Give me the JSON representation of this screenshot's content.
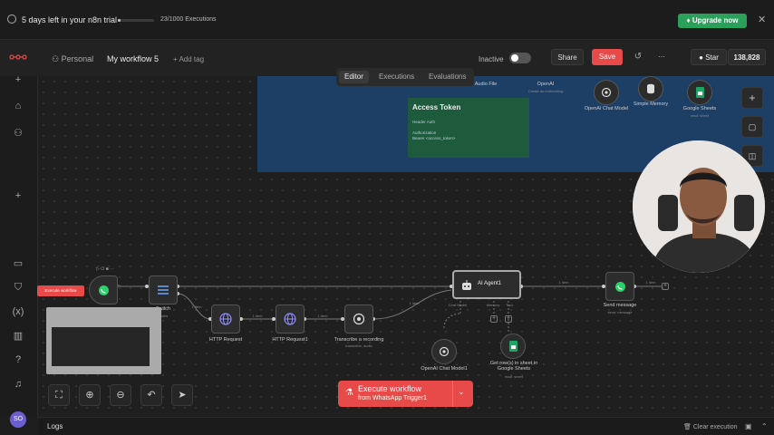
{
  "banner": {
    "trial_text": "5 days left in your n8n trial",
    "executions": "23/1000 Executions",
    "upgrade_label": "Upgrade now",
    "trial_progress": 0.023
  },
  "header": {
    "project": "Personal",
    "workflow_name": "My workflow 5",
    "add_tag": "+ Add tag",
    "status_label": "Inactive",
    "share_label": "Share",
    "save_label": "Save",
    "star_label": "Star",
    "star_count": "138,828"
  },
  "tabs": [
    "Editor",
    "Executions",
    "Evaluations"
  ],
  "note": {
    "title": "Access Token",
    "lines": [
      "Header Auth",
      "Authorization",
      "Bearer <access_token>"
    ]
  },
  "top_nodes": {
    "audio_file": "Audio File",
    "openai_top": "OpenAI",
    "openai_top_sub": "Create an embedding",
    "openai_chat_model_top": "OpenAI Chat Model",
    "simple_memory": "Simple Memory",
    "google_sheets": "Google Sheets",
    "google_sheets_sub": "read: sheet"
  },
  "nodes": {
    "switch": "Switch",
    "switch_sub": "Rules",
    "http_request": "HTTP Request",
    "http_request1": "HTTP Request1",
    "transcribe": "Transcribe a recording",
    "transcribe_sub": "transcribe: audio",
    "ai_agent": "AI Agent1",
    "agent_chat_model": "Chat Model",
    "agent_memory": "Memory",
    "agent_tool": "Tool",
    "openai_chat_model": "OpenAI Chat Model1",
    "get_rows": "Get row(s) in sheet in Google Sheets",
    "get_rows_sub": "read: sheet",
    "send_message": "Send message",
    "send_message_sub": "send: message"
  },
  "edges": {
    "e1": "1 item",
    "e2": "1 item",
    "e3": "1 item",
    "e4": "1 item",
    "e5": "1 item",
    "e6": "1 item",
    "e7": "1 item"
  },
  "execute_tag": "Execute workflow",
  "execute_button": {
    "line1": "Execute workflow",
    "line2": "from WhatsApp Trigger1"
  },
  "logs": {
    "title": "Logs",
    "clear": "Clear execution"
  },
  "user_initials": "SO",
  "colors": {
    "accent_red": "#e84a4a",
    "upgrade_green": "#2aa05a",
    "whatsapp_green": "#25d366",
    "sheets_green": "#1fa463",
    "note_green": "#1e5a3c",
    "region_blue": "#1d3f66"
  }
}
